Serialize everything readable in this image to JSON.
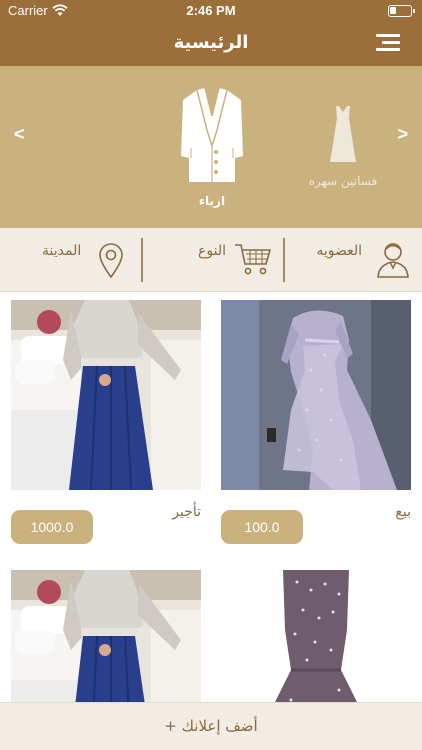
{
  "status_bar": {
    "carrier": "Carrier",
    "time": "2:46 PM",
    "battery_level": 0.3
  },
  "nav": {
    "title": "الرئيسية",
    "menu_icon": "hamburger-menu-icon"
  },
  "carousel": {
    "prev_label": "<",
    "next_label": ">",
    "active_category": {
      "label": "ازياء",
      "icon": "suit-jacket-icon"
    },
    "side_category": {
      "label": "فساتين سهره",
      "icon": "evening-dress-icon"
    }
  },
  "filters": [
    {
      "label": "العضويه",
      "icon": "user-icon"
    },
    {
      "label": "النوع",
      "icon": "cart-icon"
    },
    {
      "label": "المدينة",
      "icon": "location-pin-icon"
    }
  ],
  "products": [
    {
      "kind": "بيع",
      "price": "100.0"
    },
    {
      "kind": "تأجير",
      "price": "1000.0"
    },
    {
      "kind": "",
      "price": ""
    },
    {
      "kind": "",
      "price": ""
    }
  ],
  "add_listing": {
    "label": "+ أضف إعلانك"
  },
  "colors": {
    "brand_brown": "#9b6e3a",
    "gold": "#c9b27e",
    "cream": "#f1ede4",
    "accent_text": "#8b6a3d"
  }
}
